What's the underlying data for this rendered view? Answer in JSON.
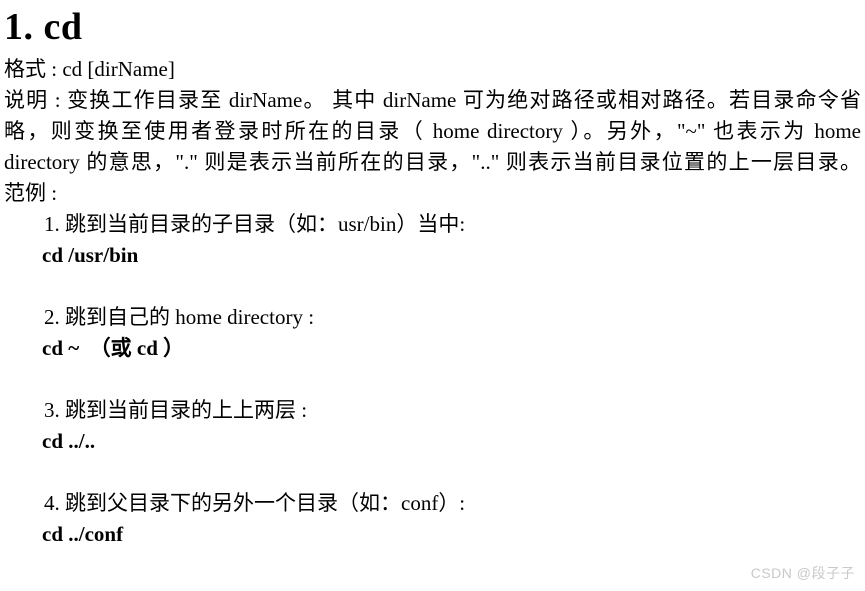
{
  "document": {
    "heading": "1. cd",
    "format_line": "格式 : cd [dirName]",
    "description": {
      "line1": "说明 : 变换工作目录至 dirName。 其中 dirName 可为绝对路径或相对路径。若目录命令省",
      "line2": "略，则变换至使用者登录时所在的目录（ home directory ）。另外，\"~\" 也表示为 home",
      "line3": "directory 的意思，\".\" 则是表示当前所在的目录，\"..\" 则表示当前目录位置的上一层目录。"
    },
    "examples_label": "范例 :",
    "examples": [
      {
        "title": "1. 跳到当前目录的子目录（如：usr/bin）当中:",
        "command": "cd /usr/bin"
      },
      {
        "title": "2. 跳到自己的 home directory :",
        "command": "cd ~  （或 cd ）"
      },
      {
        "title": "3. 跳到当前目录的上上两层 :",
        "command": "cd ../.."
      },
      {
        "title": "4. 跳到父目录下的另外一个目录（如：conf）:",
        "command": "cd ../conf"
      }
    ]
  },
  "watermark": {
    "text": "CSDN @段子子",
    "color": "#c9c9c9"
  }
}
